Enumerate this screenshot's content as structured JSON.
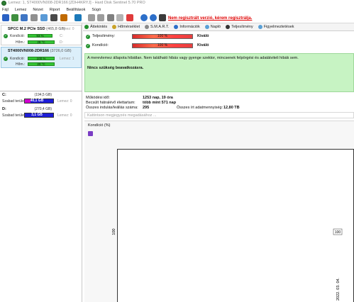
{
  "title": "Lemez: 1, ST4000VN008-2DR166 [ZDH4KRYJ] - Hard Disk Sentinel 5.70 PRO",
  "menu": [
    "Fájl",
    "Lemez",
    "Nézet",
    "Riport",
    "Beállítások",
    "Súgó"
  ],
  "warning": "Nem regisztrált verzió, kérem regisztrálja.",
  "disks": [
    {
      "name": "SPCC M.2 PCIe SSD",
      "size": "(465,8 GB)",
      "drive": "Lemez: 0",
      "health_label": "Kondíció:",
      "health": "93 %",
      "health_level": 0.93,
      "temp_label": "Hőm.:",
      "temp": "28 °C",
      "temp_level": 1.0,
      "letters_1": "C:",
      "letters_2": "D:"
    },
    {
      "name": "ST4000VN008-2DR166",
      "size": "(3726,0 GB)",
      "drive": "Lemez: 1",
      "health_label": "Kondíció:",
      "health": "100 %",
      "health_level": 1.0,
      "temp_label": "Hőm.:",
      "temp": "20 °C",
      "temp_level": 1.0
    }
  ],
  "volumes": [
    {
      "name": "C:",
      "size": "(194,5 GB)",
      "free_label": "Szabad terület",
      "free": "40,1 GB",
      "disk": "Lemez: 0",
      "free_level": 0.21
    },
    {
      "name": "D:",
      "size": "(270,4 GB)",
      "free_label": "Szabad terület",
      "free": "3,1 GB",
      "disk": "Lemez: 0",
      "free_level": 0.01
    }
  ],
  "tabs": [
    "Áttekintés",
    "Hőmérséklet",
    "S.M.A.R.T.",
    "Információk",
    "Napló",
    "Teljesítmény",
    "Figyelmeztetések"
  ],
  "status": {
    "performance_label": "Teljesítmény:",
    "performance": "100 %",
    "performance_text": "Kiváló",
    "health_label": "Kondíció:",
    "health": "100 %",
    "health_text": "Kiváló"
  },
  "summary": {
    "line1": "A merevlemez állapota hibátlan. Nem található hibás vagy gyenge szektor, mincsenek felpörgési és adatátviteli hibák sem.",
    "line2": "Nincs szükség beavatkozásra."
  },
  "info": {
    "uptime_label": "Működési idő:",
    "uptime": "1253 nap, 19 óra",
    "remaining_label": "Becsült hátralévő élettartam:",
    "remaining": "több mint 571 nap",
    "starts_label": "Összes indulás/leállás száma:",
    "starts": "295",
    "written_label": "Összes írt adatmennyiség:",
    "written": "12,80 TB"
  },
  "comment_placeholder": "Kattintson megjegyzés megadásához ...",
  "chart_header": "Kondíció  (%)",
  "chart_data": {
    "type": "line",
    "title": "Kondíció  (%)",
    "ylabel": "",
    "xlabel": "",
    "y_tick_labels": [
      "100"
    ],
    "x_tick_labels": [
      "2022. 03. 04."
    ],
    "series": [
      {
        "x": [
          "2022. 03. 04."
        ],
        "values": [
          100
        ]
      }
    ],
    "data_labels": [
      "100"
    ]
  }
}
